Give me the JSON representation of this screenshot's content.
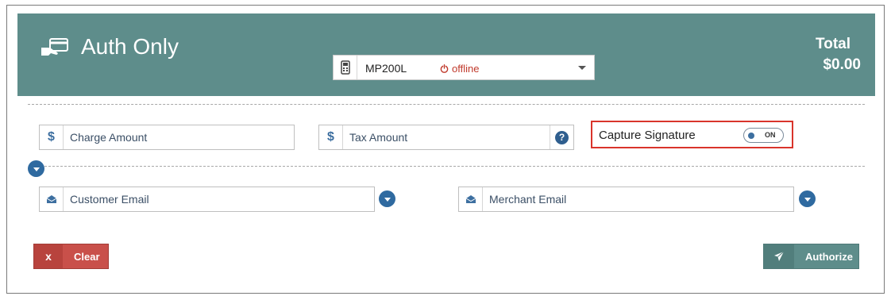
{
  "header": {
    "title": "Auth Only",
    "icon": "card-payment-icon",
    "total_label": "Total",
    "total_value": "$0.00",
    "bg_color": "#5e8d8b"
  },
  "device": {
    "name": "MP200L",
    "status": "offline",
    "status_color": "#c0392b"
  },
  "fields": {
    "charge_amount": {
      "prefix": "$",
      "placeholder": "Charge Amount"
    },
    "tax_amount": {
      "prefix": "$",
      "placeholder": "Tax Amount",
      "help": "?"
    },
    "customer_email": {
      "placeholder": "Customer Email"
    },
    "merchant_email": {
      "placeholder": "Merchant Email"
    }
  },
  "capture_signature": {
    "label": "Capture Signature",
    "toggle_text": "ON",
    "highlight_color": "#d9342b"
  },
  "buttons": {
    "clear": {
      "icon": "x",
      "label": "Clear",
      "color": "#c9504a"
    },
    "authorize": {
      "label": "Authorize",
      "color": "#5e8d8b"
    }
  }
}
